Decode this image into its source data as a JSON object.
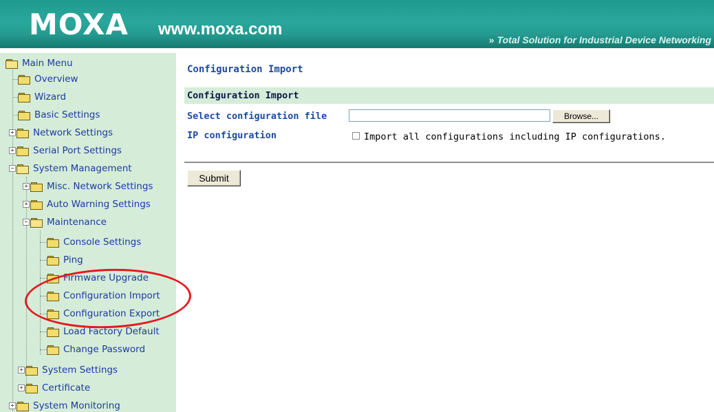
{
  "header": {
    "logo": "MOXA",
    "url": "www.moxa.com",
    "tagline_chevron": "»",
    "tagline": "Total Solution for Industrial Device Networking"
  },
  "sidebar": {
    "root": "Main Menu",
    "items": [
      {
        "label": "Overview"
      },
      {
        "label": "Wizard"
      },
      {
        "label": "Basic Settings"
      },
      {
        "label": "Network Settings",
        "toggle": "+"
      },
      {
        "label": "Serial Port Settings",
        "toggle": "+"
      },
      {
        "label": "System Management",
        "toggle": "−"
      },
      {
        "label": "Misc. Network Settings",
        "toggle": "+"
      },
      {
        "label": "Auto Warning Settings",
        "toggle": "+"
      },
      {
        "label": "Maintenance",
        "toggle": "−"
      },
      {
        "label": "Console Settings"
      },
      {
        "label": "Ping"
      },
      {
        "label": "Firmware Upgrade"
      },
      {
        "label": "Configuration Import"
      },
      {
        "label": "Configuration Export"
      },
      {
        "label": "Load Factory Default"
      },
      {
        "label": "Change Password"
      },
      {
        "label": "System Settings",
        "toggle": "+"
      },
      {
        "label": "Certificate",
        "toggle": "+"
      },
      {
        "label": "System Monitoring",
        "toggle": "+"
      }
    ]
  },
  "main": {
    "title": "Configuration Import",
    "section": "Configuration Import",
    "file_label": "Select configuration file",
    "file_value": "",
    "browse_label": "Browse...",
    "ip_label": "IP configuration",
    "ip_checked": false,
    "ip_checkbox_text": "Import all configurations including IP configurations.",
    "submit_label": "Submit"
  },
  "colors": {
    "header": "#2aa79c",
    "sidebar_bg": "#d5ecd9",
    "link": "#1d3a9e",
    "annotation": "#e3191f"
  }
}
